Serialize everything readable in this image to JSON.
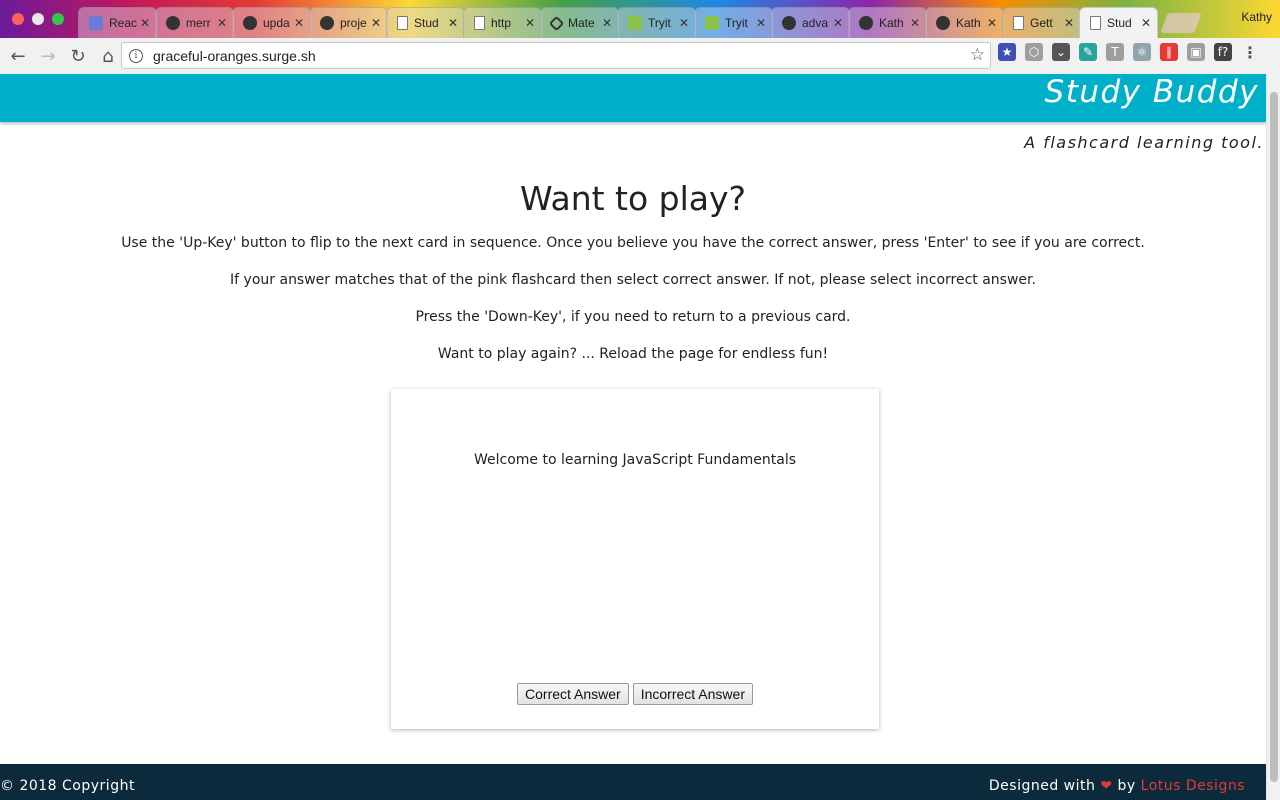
{
  "browser": {
    "tabs": [
      {
        "title": "Reac",
        "icon": "react-icon"
      },
      {
        "title": "merr",
        "icon": "github-icon"
      },
      {
        "title": "upda",
        "icon": "github-icon"
      },
      {
        "title": "proje",
        "icon": "github-icon"
      },
      {
        "title": "Stud",
        "icon": "document-icon"
      },
      {
        "title": "http",
        "icon": "document-icon"
      },
      {
        "title": "Mate",
        "icon": "codepen-icon"
      },
      {
        "title": "Tryit",
        "icon": "w3schools-icon"
      },
      {
        "title": "Tryit",
        "icon": "w3schools-icon"
      },
      {
        "title": "adva",
        "icon": "github-icon"
      },
      {
        "title": "Kath",
        "icon": "github-icon"
      },
      {
        "title": "Kath",
        "icon": "github-icon"
      },
      {
        "title": "Gett",
        "icon": "document-icon"
      },
      {
        "title": "Stud",
        "icon": "document-icon",
        "active": true
      }
    ],
    "close_glyph": "✕",
    "profile_name": "Kathy",
    "url": "graceful-oranges.surge.sh",
    "extensions": [
      {
        "name": "bookmark-extension-icon",
        "color": "#3f51b5",
        "glyph": "★"
      },
      {
        "name": "shield-extension-icon",
        "color": "#9e9e9e",
        "glyph": "⬡"
      },
      {
        "name": "pocket-extension-icon",
        "color": "#555555",
        "glyph": "⌄"
      },
      {
        "name": "dropper-extension-icon",
        "color": "#26a69a",
        "glyph": "✎"
      },
      {
        "name": "text-extension-icon",
        "color": "#9e9e9e",
        "glyph": "T"
      },
      {
        "name": "react-devtools-icon",
        "color": "#90a4ae",
        "glyph": "⚛"
      },
      {
        "name": "analytics-extension-icon",
        "color": "#e53935",
        "glyph": "∥"
      },
      {
        "name": "window-extension-icon",
        "color": "#9e9e9e",
        "glyph": "▣"
      },
      {
        "name": "font-extension-icon",
        "color": "#444444",
        "glyph": "f?"
      }
    ]
  },
  "site": {
    "brand": "Study Buddy",
    "tagline": "A flashcard learning tool.",
    "title": "Want to play?",
    "instructions": [
      "Use the 'Up-Key' button to flip to the next card in sequence. Once you believe you have the correct answer, press 'Enter' to see if you are correct.",
      "If your answer matches that of the pink flashcard then select correct answer. If not, please select incorrect answer.",
      "Press the 'Down-Key', if you need to return to a previous card.",
      "Want to play again? ... Reload the page for endless fun!"
    ],
    "card": {
      "text": "Welcome to learning JavaScript Fundamentals",
      "correct_label": "Correct Answer",
      "incorrect_label": "Incorrect Answer"
    },
    "footer": {
      "copyright": "© 2018 Copyright",
      "designed_prefix": "Designed with",
      "heart": "❤",
      "by": "by",
      "designer": "Lotus Designs"
    }
  },
  "colors": {
    "header": "#00b0c8",
    "footer": "#0b2a3c",
    "accent": "#e53935"
  }
}
